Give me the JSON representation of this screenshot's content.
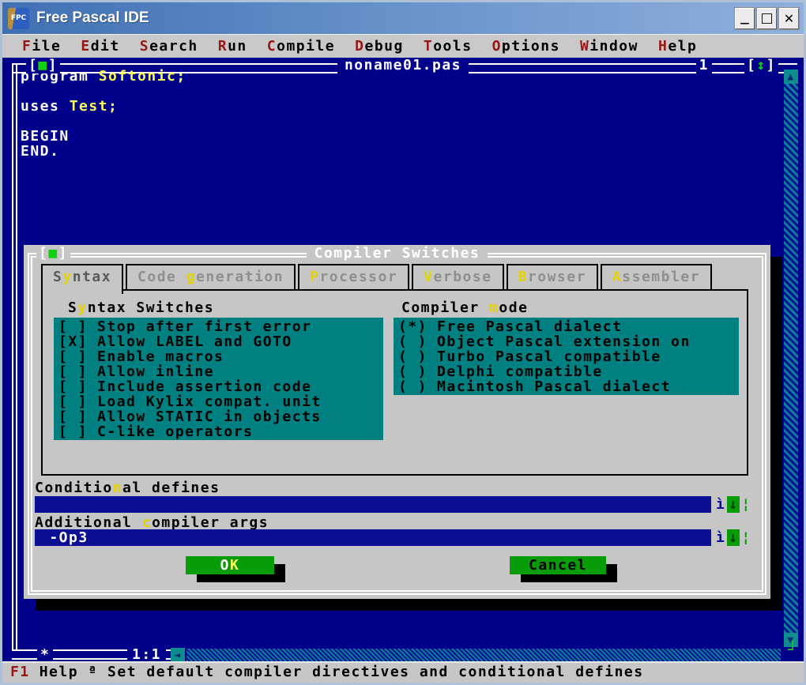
{
  "app": {
    "title": "Free Pascal IDE",
    "icon_text": "FPC",
    "controls": {
      "minimize": "—",
      "maximize": "□",
      "close": "✕"
    }
  },
  "menu": {
    "items": [
      {
        "hot": "F",
        "rest": "ile"
      },
      {
        "hot": "E",
        "rest": "dit"
      },
      {
        "hot": "S",
        "rest": "earch"
      },
      {
        "hot": "R",
        "rest": "un"
      },
      {
        "hot": "C",
        "rest": "ompile"
      },
      {
        "hot": "D",
        "rest": "ebug"
      },
      {
        "hot": "T",
        "rest": "ools"
      },
      {
        "hot": "O",
        "rest": "ptions"
      },
      {
        "hot": "W",
        "rest": "indow"
      },
      {
        "hot": "H",
        "rest": "elp"
      }
    ]
  },
  "editor": {
    "close_box": {
      "open": "[",
      "glyph": "■",
      "close": "]"
    },
    "title": "noname01.pas",
    "window_number": "1",
    "zoom_box": {
      "open": "[",
      "glyph": "↕",
      "close": "]"
    },
    "code": {
      "line1_keyword": "program ",
      "line1_ident": "Softonic;",
      "line3_keyword": "uses ",
      "line3_ident": "Test;",
      "line5": "BEGIN",
      "line6": "END."
    },
    "modified_flag": "*",
    "cursor_position": "1:1",
    "scrollbar": {
      "up": "▲",
      "down": "▼",
      "left": "◄",
      "resize_corner": "┘"
    }
  },
  "dialog": {
    "title": "Compiler Switches",
    "close_box": {
      "open": "[",
      "glyph": "■",
      "close": "]"
    },
    "tabs": [
      {
        "pre": "S",
        "hot": "y",
        "post": "ntax"
      },
      {
        "pre": "Code ",
        "hot": "g",
        "post": "eneration"
      },
      {
        "pre": "",
        "hot": "P",
        "post": "rocessor"
      },
      {
        "pre": "",
        "hot": "V",
        "post": "erbose"
      },
      {
        "pre": "",
        "hot": "B",
        "post": "rowser"
      },
      {
        "pre": "",
        "hot": "A",
        "post": "ssembler"
      }
    ],
    "syntax_switches": {
      "label": {
        "pre": "S",
        "hot": "y",
        "post": "ntax Switches"
      },
      "items": [
        {
          "state": "[ ]",
          "label": "Stop after first error"
        },
        {
          "state": "[X]",
          "label": "Allow LABEL and GOTO"
        },
        {
          "state": "[ ]",
          "label": "Enable macros"
        },
        {
          "state": "[ ]",
          "label": "Allow inline"
        },
        {
          "state": "[ ]",
          "label": "Include assertion code"
        },
        {
          "state": "[ ]",
          "label": "Load Kylix compat. unit"
        },
        {
          "state": "[ ]",
          "label": "Allow STATIC in objects"
        },
        {
          "state": "[ ]",
          "label": "C-like operators"
        }
      ]
    },
    "compiler_mode": {
      "label": {
        "pre": "Compiler ",
        "hot": "m",
        "post": "ode"
      },
      "items": [
        {
          "state": "(*)",
          "label": "Free Pascal dialect"
        },
        {
          "state": "( )",
          "label": "Object Pascal extension on"
        },
        {
          "state": "( )",
          "label": "Turbo Pascal compatible"
        },
        {
          "state": "( )",
          "label": "Delphi compatible"
        },
        {
          "state": "( )",
          "label": "Macintosh Pascal dialect"
        }
      ]
    },
    "conditional_defines": {
      "label": {
        "pre": "Conditio",
        "hot": "n",
        "post": "al defines"
      },
      "value": "",
      "history": {
        "pre": "ì",
        "glyph": "↓",
        "post": "¦"
      }
    },
    "additional_args": {
      "label": {
        "pre": "Additional ",
        "hot": "c",
        "post": "ompiler args"
      },
      "value": " -Op3",
      "history": {
        "pre": "ì",
        "glyph": "↓",
        "post": "¦"
      }
    },
    "buttons": {
      "ok_pre": "O",
      "ok_hot": "K",
      "cancel": "Cancel"
    }
  },
  "statusbar": {
    "key": "F1",
    "text": "Help ª Set default compiler directives and conditional defines"
  }
}
